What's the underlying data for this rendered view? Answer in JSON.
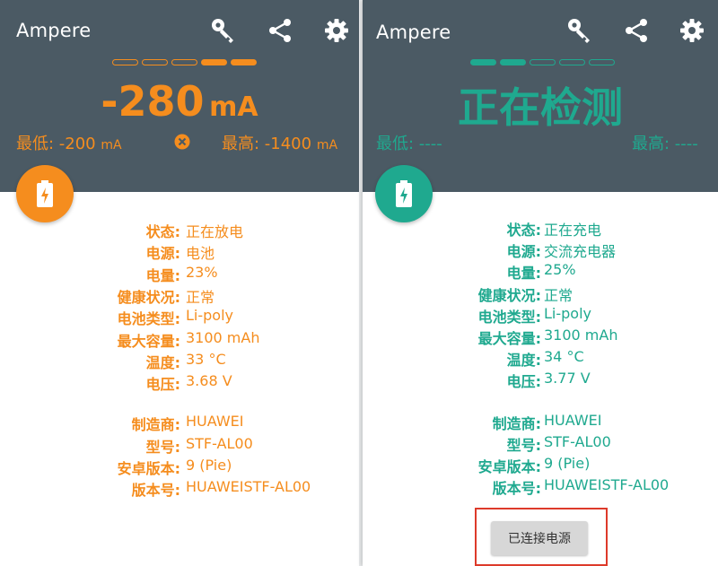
{
  "colors": {
    "header_bg": "#4b5a64",
    "discharge_accent": "#f58d1e",
    "charge_accent": "#1fa98f",
    "highlight_box": "#dd3a2a"
  },
  "left": {
    "app_title": "Ampere",
    "icons": [
      "key-icon",
      "share-icon",
      "gear-icon"
    ],
    "level_dashes_filled": [
      false,
      false,
      false,
      true,
      true
    ],
    "current_value": "-280",
    "current_unit": "mA",
    "min_label": "最低: -200",
    "min_unit": "mA",
    "max_label": "最高: -1400",
    "max_unit": "mA",
    "clear_icon": "close-circle-icon",
    "fab_icon": "battery-charging-icon",
    "status_rows": [
      {
        "label": "状态:",
        "value": "正在放电"
      },
      {
        "label": "电源:",
        "value": "电池"
      },
      {
        "label": "电量:",
        "value": "23%"
      },
      {
        "label": "健康状况:",
        "value": "正常"
      },
      {
        "label": "电池类型:",
        "value": "Li-poly"
      },
      {
        "label": "最大容量:",
        "value": "3100 mAh"
      },
      {
        "label": "温度:",
        "value": "33 °C"
      },
      {
        "label": "电压:",
        "value": "3.68 V"
      }
    ],
    "device_rows": [
      {
        "label": "制造商:",
        "value": "HUAWEI"
      },
      {
        "label": "型号:",
        "value": "STF-AL00"
      },
      {
        "label": "安卓版本:",
        "value": "9 (Pie)"
      },
      {
        "label": "版本号:",
        "value": "HUAWEISTF-AL00"
      }
    ]
  },
  "right": {
    "app_title": "Ampere",
    "icons": [
      "key-icon",
      "share-icon",
      "gear-icon"
    ],
    "level_dashes_filled": [
      true,
      true,
      false,
      false,
      false
    ],
    "measuring_text": "正在检测",
    "min_label": "最低: ----",
    "max_label": "最高: ----",
    "fab_icon": "battery-charging-icon",
    "status_rows": [
      {
        "label": "状态:",
        "value": "正在充电"
      },
      {
        "label": "电源:",
        "value": "交流充电器"
      },
      {
        "label": "电量:",
        "value": "25%"
      },
      {
        "label": "健康状况:",
        "value": "正常"
      },
      {
        "label": "电池类型:",
        "value": "Li-poly"
      },
      {
        "label": "最大容量:",
        "value": "3100 mAh"
      },
      {
        "label": "温度:",
        "value": "34 °C"
      },
      {
        "label": "电压:",
        "value": "3.77 V"
      }
    ],
    "device_rows": [
      {
        "label": "制造商:",
        "value": "HUAWEI"
      },
      {
        "label": "型号:",
        "value": "STF-AL00"
      },
      {
        "label": "安卓版本:",
        "value": "9 (Pie)"
      },
      {
        "label": "版本号:",
        "value": "HUAWEISTF-AL00"
      }
    ],
    "connect_button_label": "已连接电源"
  }
}
